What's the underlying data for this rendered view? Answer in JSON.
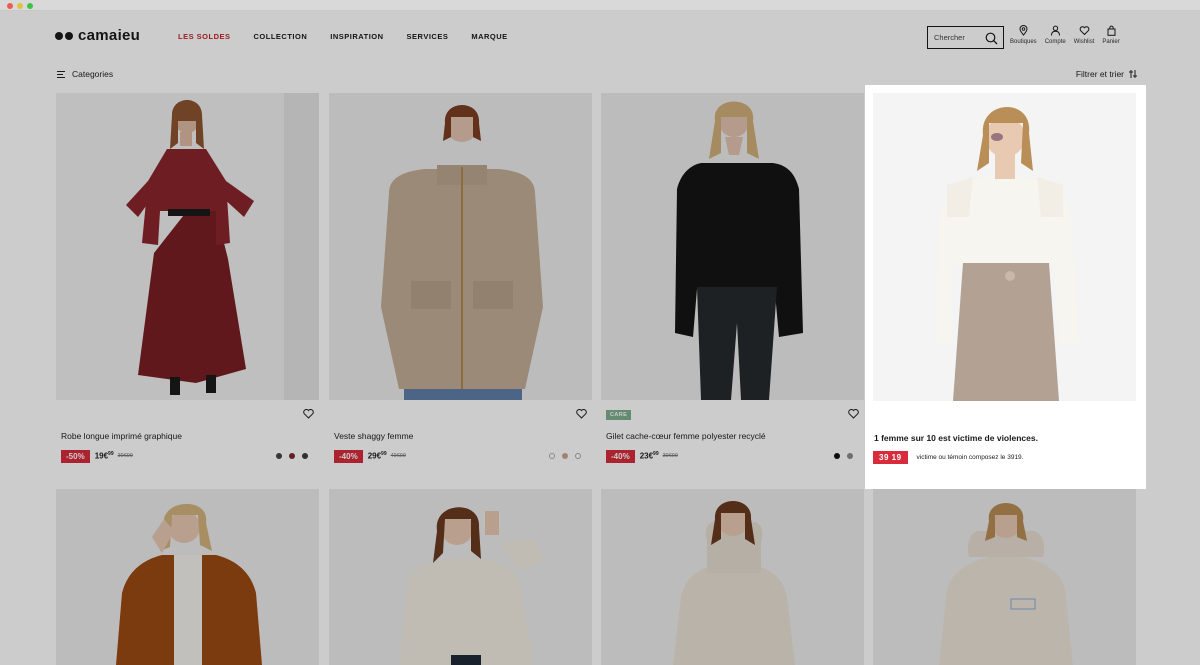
{
  "colors": {
    "sale": "#c2272d",
    "discount": "#d82c3c",
    "care_badge": "#7fae8f"
  },
  "header": {
    "logo": "camaieu",
    "nav": [
      "LES SOLDES",
      "COLLECTION",
      "INSPIRATION",
      "SERVICES",
      "MARQUE"
    ],
    "search_placeholder": "Chercher",
    "icons": [
      {
        "icon": "store-pin-icon",
        "label": "Boutiques"
      },
      {
        "icon": "user-icon",
        "label": "Compte"
      },
      {
        "icon": "heart-icon",
        "label": "Wishlist"
      },
      {
        "icon": "bag-icon",
        "label": "Panier"
      }
    ]
  },
  "toolbar": {
    "categories": "Categories",
    "filter": "Filtrer et trier"
  },
  "products": [
    {
      "name": "Robe longue imprimé graphique",
      "discount": "-50%",
      "price": "19€",
      "price_cents": "99",
      "old_price": "39€99",
      "swatches": [
        "#444444",
        "#7a2a2a",
        "#3c3c3c"
      ]
    },
    {
      "name": "Veste shaggy femme",
      "discount": "-40%",
      "price": "29€",
      "price_cents": "99",
      "old_price": "49€99",
      "swatches": [
        "#d8d8d8",
        "#c9a58d",
        "#e6e6e6"
      ]
    },
    {
      "name": "Gilet cache-cœur femme polyester recyclé",
      "badge": "CARE",
      "discount": "-40%",
      "price": "23€",
      "price_cents": "99",
      "old_price": "39€99",
      "swatches": [
        "#111111",
        "#8a8a8a"
      ]
    }
  ],
  "campaign": {
    "title": "1 femme sur 10 est victime de violences.",
    "number": "39 19",
    "text": "victime ou témoin composez le 3919."
  }
}
